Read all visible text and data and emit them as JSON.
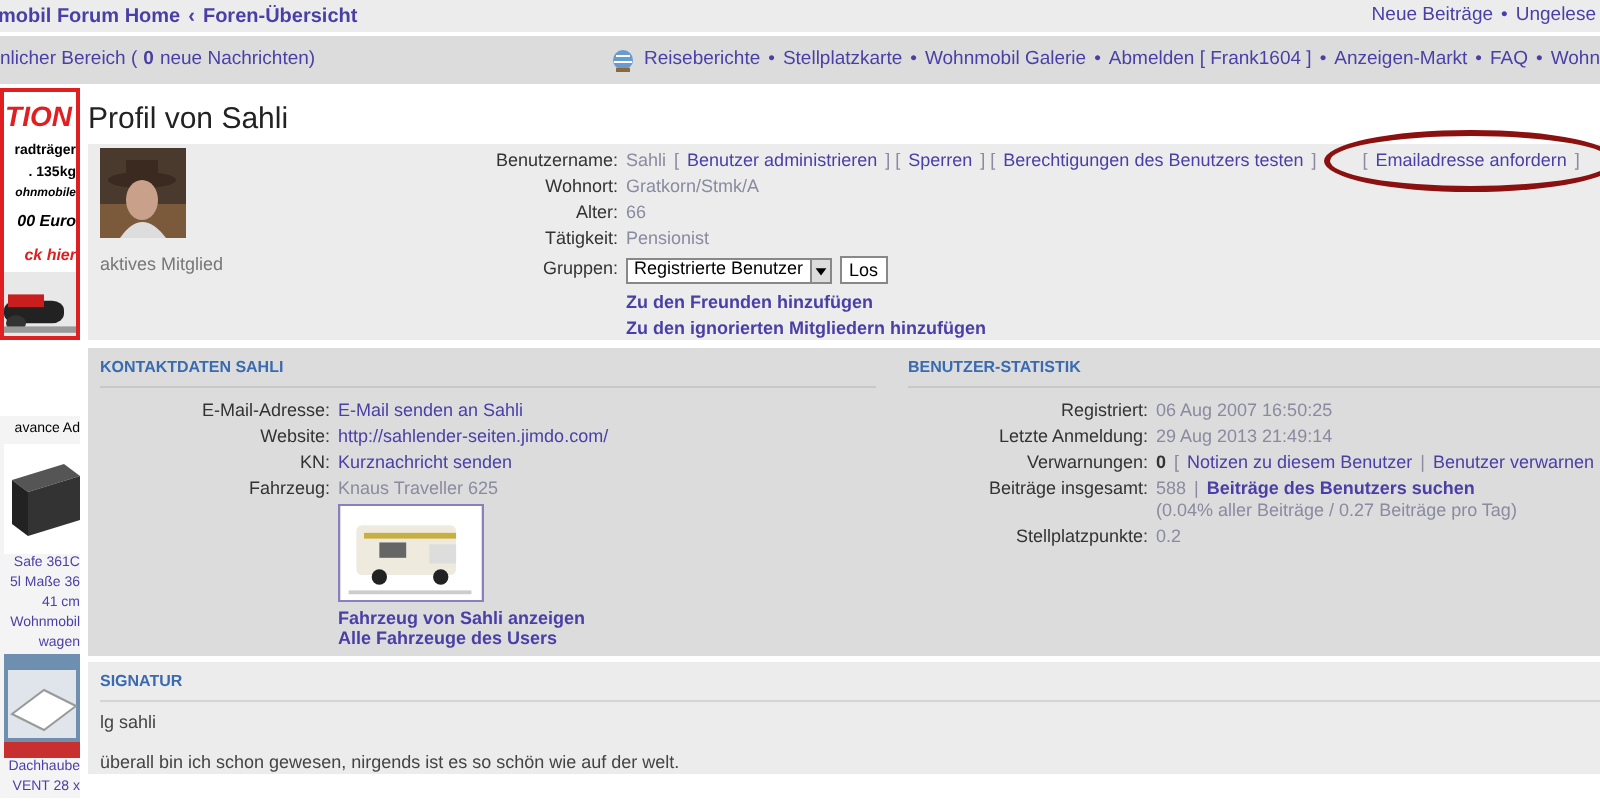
{
  "top_bar": {
    "breadcrumbs": [
      "mobil Forum Home",
      "‹",
      "Foren-Übersicht"
    ],
    "right_links": [
      "Neue Beiträge",
      "•",
      "Ungelese"
    ]
  },
  "nav_bar": {
    "left": [
      {
        "text": "nlicher Bereich (",
        "kind": "text"
      },
      {
        "text": "0",
        "kind": "bold"
      },
      {
        "text": "neue Nachrichten)",
        "kind": "text"
      }
    ],
    "separator": "•",
    "links": [
      "Reiseberichte",
      "Stellplatzkarte",
      "Wohnmobil Galerie",
      "Abmelden [ Frank1604 ]",
      "Anzeigen-Markt",
      "FAQ",
      "Wohn"
    ]
  },
  "sidebar": {
    "items": [
      {
        "kind": "red-heading",
        "text": "TION"
      },
      {
        "kind": "bold",
        "text": "radträger"
      },
      {
        "kind": "bold",
        "text": ". 135kg"
      },
      {
        "kind": "small-bold",
        "text": "ohnmobile"
      },
      {
        "kind": "italic-bold",
        "text": "00 Euro"
      },
      {
        "kind": "red-italic",
        "text": "ck hier"
      },
      {
        "kind": "picture"
      },
      {
        "kind": "label",
        "text": "avance Ad"
      },
      {
        "kind": "picture"
      },
      {
        "kind": "link",
        "text": "Safe 361C"
      },
      {
        "kind": "link",
        "text": "5l Maße 36"
      },
      {
        "kind": "link",
        "text": "41 cm"
      },
      {
        "kind": "link",
        "text": "Wohnmobil"
      },
      {
        "kind": "link",
        "text": "wagen"
      },
      {
        "kind": "picture"
      },
      {
        "kind": "link",
        "text": "Dachhaube"
      },
      {
        "kind": "link",
        "text": "VENT 28 x"
      }
    ]
  },
  "profile": {
    "title": "Profil von Sahli",
    "status": "aktives Mitglied",
    "fields": [
      {
        "label": "Benutzername:",
        "parts": [
          {
            "kind": "text",
            "text": "Sahli"
          },
          {
            "kind": "plain",
            "text": "["
          },
          {
            "kind": "link",
            "text": "Benutzer administrieren"
          },
          {
            "kind": "plain",
            "text": "] ["
          },
          {
            "kind": "link",
            "text": "Sperren"
          },
          {
            "kind": "plain",
            "text": "] ["
          },
          {
            "kind": "link",
            "text": "Berechtigungen des Benutzers testen"
          },
          {
            "kind": "plain",
            "text": "]"
          },
          {
            "kind": "circled",
            "parts": [
              {
                "kind": "plain",
                "text": "["
              },
              {
                "kind": "link",
                "text": "Emailadresse anfordern"
              },
              {
                "kind": "plain",
                "text": "]"
              }
            ]
          }
        ]
      },
      {
        "label": "Wohnort:",
        "parts": [
          {
            "kind": "text",
            "text": "Gratkorn/Stmk/A"
          }
        ]
      },
      {
        "label": "Alter:",
        "parts": [
          {
            "kind": "text",
            "text": "66"
          }
        ]
      },
      {
        "label": "Tätigkeit:",
        "parts": [
          {
            "kind": "text",
            "text": "Pensionist"
          }
        ]
      }
    ],
    "groups": {
      "label": "Gruppen:",
      "value": "Registrierte Benutzer",
      "button": "Los"
    },
    "actions": [
      "Zu den Freunden hinzufügen",
      "Zu den ignorierten Mitgliedern hinzufügen"
    ]
  },
  "contact": {
    "heading": "KONTAKTDATEN SAHLI",
    "fields": [
      {
        "label": "E-Mail-Adresse:",
        "parts": [
          {
            "kind": "link",
            "text": "E-Mail senden an Sahli"
          }
        ]
      },
      {
        "label": "Website:",
        "parts": [
          {
            "kind": "link",
            "text": "http://sahlender-seiten.jimdo.com/"
          }
        ]
      },
      {
        "label": "KN:",
        "parts": [
          {
            "kind": "link",
            "text": "Kurznachricht senden"
          }
        ]
      },
      {
        "label": "Fahrzeug:",
        "parts": [
          {
            "kind": "text",
            "text": "Knaus Traveller 625"
          }
        ]
      }
    ],
    "vehicle_links": [
      "Fahrzeug von Sahli anzeigen",
      "Alle Fahrzeuge des Users"
    ]
  },
  "statistics": {
    "heading": "BENUTZER-STATISTIK",
    "fields": [
      {
        "label": "Registriert:",
        "parts": [
          {
            "kind": "text",
            "text": "06 Aug 2007 16:50:25"
          }
        ]
      },
      {
        "label": "Letzte Anmeldung:",
        "parts": [
          {
            "kind": "text",
            "text": "29 Aug 2013 21:49:14"
          }
        ]
      },
      {
        "label": "Verwarnungen:",
        "parts": [
          {
            "kind": "bold",
            "text": "0"
          },
          {
            "kind": "plain",
            "text": "["
          },
          {
            "kind": "link",
            "text": "Notizen zu diesem Benutzer"
          },
          {
            "kind": "plain",
            "text": "|"
          },
          {
            "kind": "link",
            "text": "Benutzer verwarnen"
          }
        ]
      },
      {
        "label": "Beiträge insgesamt:",
        "parts": [
          {
            "kind": "text",
            "text": "588"
          },
          {
            "kind": "plain",
            "text": "|"
          },
          {
            "kind": "boldlink",
            "text": "Beiträge des Benutzers suchen"
          },
          {
            "kind": "note",
            "text": "(0.04% aller Beiträge / 0.27 Beiträge pro Tag)"
          }
        ]
      },
      {
        "label": "Stellplatzpunkte:",
        "parts": [
          {
            "kind": "text",
            "text": "0.2"
          }
        ]
      }
    ]
  },
  "signature": {
    "heading": "SIGNATUR",
    "lines": [
      "lg sahli",
      "überall bin ich schon gewesen, nirgends ist es so schön wie auf der welt."
    ]
  }
}
